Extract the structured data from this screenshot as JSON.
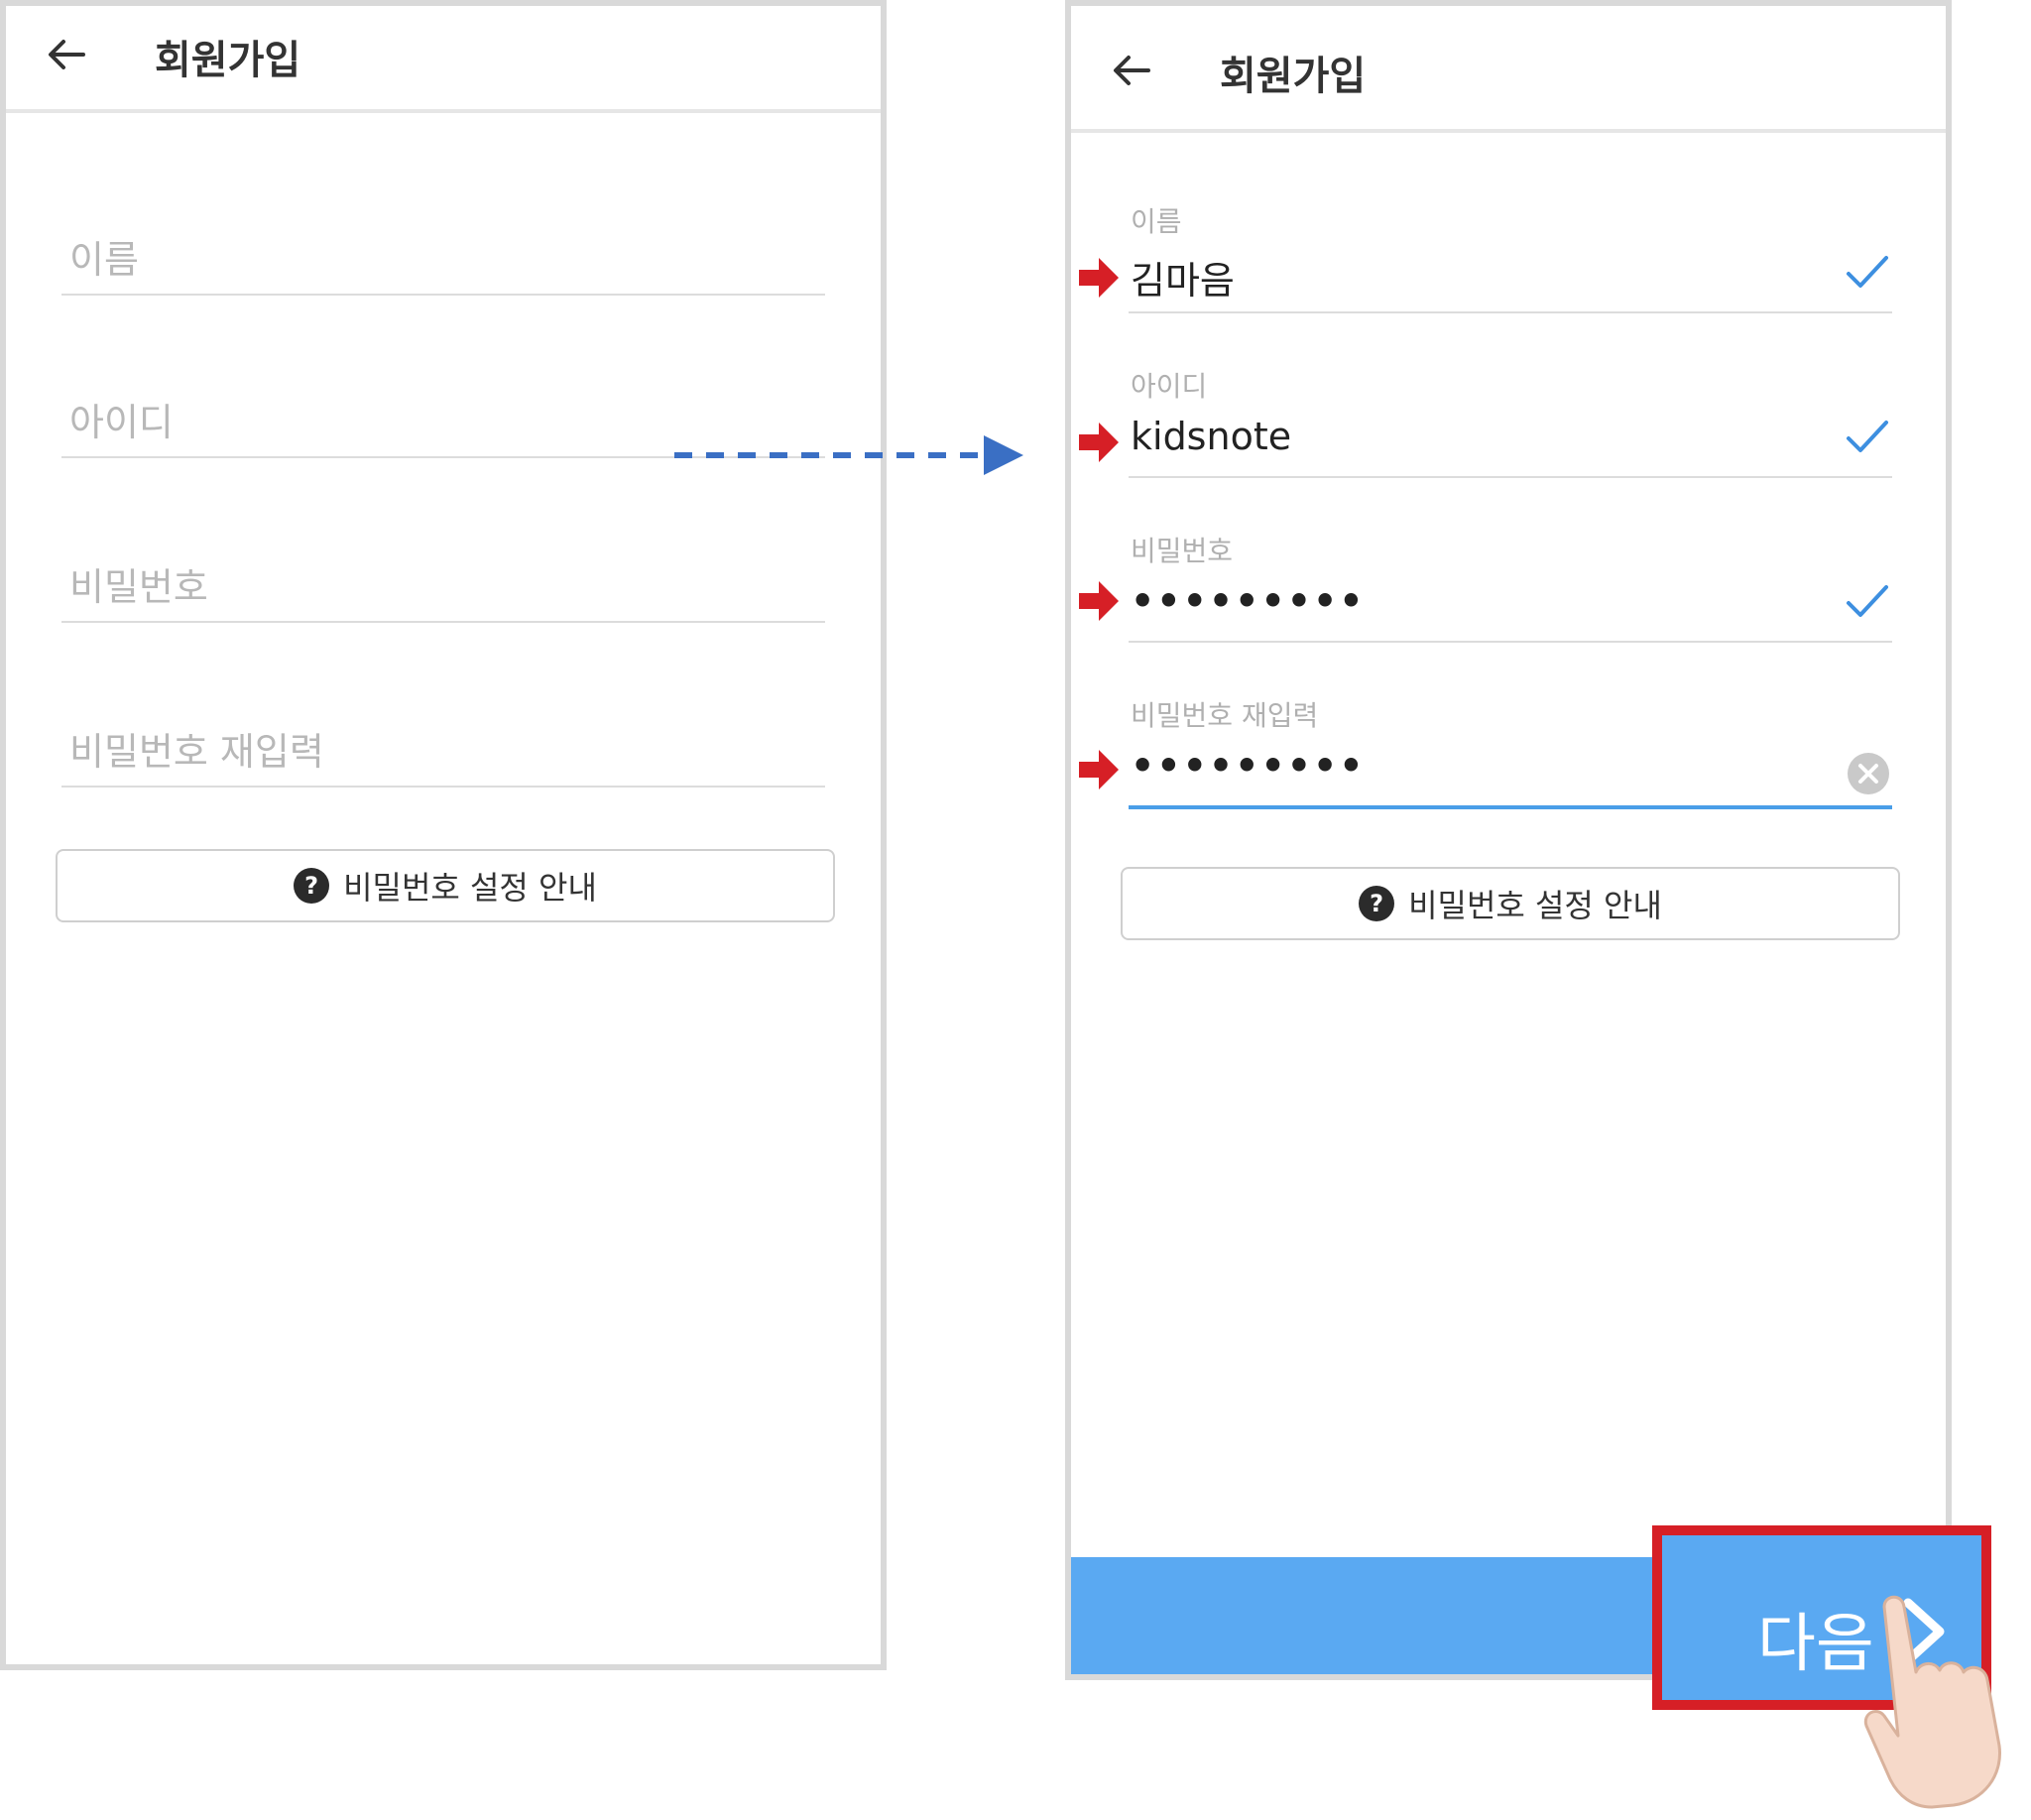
{
  "left_screen": {
    "title": "회원가입",
    "fields": [
      {
        "placeholder": "이름"
      },
      {
        "placeholder": "아이디"
      },
      {
        "placeholder": "비밀번호"
      },
      {
        "placeholder": "비밀번호 재입력"
      }
    ],
    "guide_button": {
      "icon_text": "?",
      "label": "비밀번호 설정 안내"
    }
  },
  "right_screen": {
    "title": "회원가입",
    "fields": [
      {
        "label": "이름",
        "value": "김마음",
        "status": "check-icon"
      },
      {
        "label": "아이디",
        "value": "kidsnote",
        "status": "check-icon"
      },
      {
        "label": "비밀번호",
        "value": "•••••••••",
        "status": "check-icon"
      },
      {
        "label": "비밀번호 재입력",
        "value": "•••••••••",
        "status": "clear-icon"
      }
    ],
    "guide_button": {
      "icon_text": "?",
      "label": "비밀번호 설정 안내"
    },
    "next_button": {
      "label": "다음"
    }
  },
  "colors": {
    "accent_blue": "#5aa9f2",
    "check_blue": "#3d8fe0",
    "highlight_red": "#d61f26",
    "annotation_arrow_blue": "#3a6fc4"
  }
}
